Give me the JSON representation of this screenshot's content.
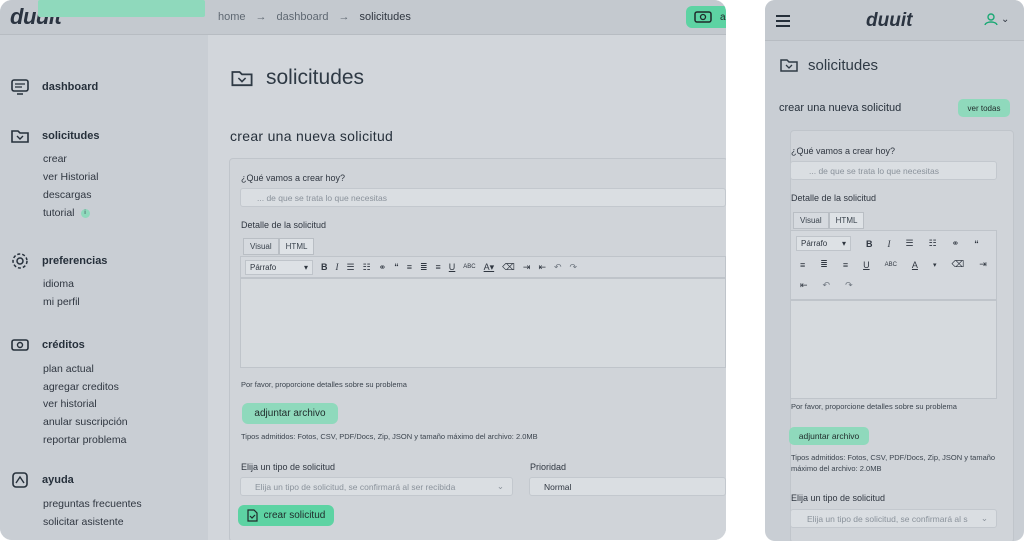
{
  "brand": {
    "logo": "duuit"
  },
  "breadcrumb": {
    "home": "home",
    "dashboard": "dashboard",
    "current": "solicitudes",
    "sep": "→"
  },
  "header": {
    "agent_label": "ag"
  },
  "sidebar": {
    "dashboard": "dashboard",
    "solicitudes": {
      "title": "solicitudes",
      "items": [
        "crear",
        "ver Historial",
        "descargas",
        "tutorial"
      ],
      "tutorial_badge": "i"
    },
    "preferencias": {
      "title": "preferencias",
      "items": [
        "idioma",
        "mi perfil"
      ]
    },
    "creditos": {
      "title": "créditos",
      "items": [
        "plan actual",
        "agregar creditos",
        "ver historial",
        "anular suscripción",
        "reportar problema"
      ]
    },
    "ayuda": {
      "title": "ayuda",
      "items": [
        "preguntas frecuentes",
        "solicitar asistente"
      ]
    }
  },
  "page": {
    "title": "solicitudes",
    "form_title": "crear una nueva solicitud",
    "view_all": "ver todas"
  },
  "form": {
    "q_label": "¿Qué vamos a crear hoy?",
    "q_placeholder": "... de que se trata lo que necesitas",
    "detail_label": "Detalle de la solicitud",
    "tab_visual": "Visual",
    "tab_html": "HTML",
    "format_select": "Párrafo",
    "detail_hint": "Por favor, proporcione detalles sobre su problema",
    "attach_button": "adjuntar archivo",
    "file_types": "Tipos admitidos: Fotos, CSV, PDF/Docs, Zip, JSON y tamaño máximo del archivo: 2.0MB",
    "type_label": "Elija un tipo de solicitud",
    "type_placeholder": "Elija un tipo de solicitud, se confirmará al ser recibida",
    "priority_label": "Prioridad",
    "priority_value": "Normal",
    "submit_button": "crear solicitud"
  },
  "mobile": {
    "file_types_line1": "Tipos admitidos: Fotos, CSV, PDF/Docs, Zip, JSON y tamaño",
    "file_types_line2": "máximo del archivo: 2.0MB",
    "type_placeholder": "Elija un tipo de solicitud, se confirmará al s"
  },
  "colors": {
    "accent": "#8fd9bc",
    "accent_strong": "#5dd3a3",
    "panel_bg": "#c9ced4",
    "text": "#2f3640"
  }
}
